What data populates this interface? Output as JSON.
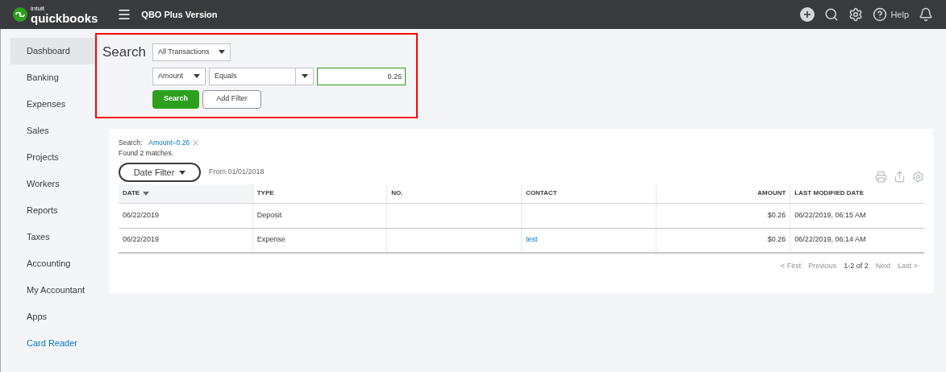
{
  "topbar": {
    "logo_small": "intuit",
    "logo": "quickbooks",
    "title": "QBO Plus Version",
    "help": "Help"
  },
  "sidebar": {
    "items": [
      {
        "label": "Dashboard",
        "selected": true,
        "kind": "page"
      },
      {
        "label": "Banking",
        "selected": false,
        "kind": "page"
      },
      {
        "label": "Expenses",
        "selected": false,
        "kind": "page"
      },
      {
        "label": "Sales",
        "selected": false,
        "kind": "page"
      },
      {
        "label": "Projects",
        "selected": false,
        "kind": "page"
      },
      {
        "label": "Workers",
        "selected": false,
        "kind": "page"
      },
      {
        "label": "Reports",
        "selected": false,
        "kind": "page"
      },
      {
        "label": "Taxes",
        "selected": false,
        "kind": "page"
      },
      {
        "label": "Accounting",
        "selected": false,
        "kind": "page"
      },
      {
        "label": "My Accountant",
        "selected": false,
        "kind": "page"
      },
      {
        "label": "Apps",
        "selected": false,
        "kind": "page"
      },
      {
        "label": "Card Reader",
        "selected": false,
        "kind": "link"
      }
    ]
  },
  "search": {
    "title": "Search",
    "transaction_type": "All Transactions",
    "field": "Amount",
    "operator": "Equals",
    "value": "0.26",
    "search_button": "Search",
    "add_filter_button": "Add Filter"
  },
  "results": {
    "search_label": "Search:",
    "search_term": "Amount=0.26",
    "found": "Found 2 matches.",
    "date_filter": "Date Filter",
    "date_range": "From 01/01/2018",
    "table": {
      "columns": [
        {
          "label": "DATE",
          "sorted": true,
          "kind": "text"
        },
        {
          "label": "TYPE",
          "sorted": false,
          "kind": "text"
        },
        {
          "label": "NO.",
          "sorted": false,
          "kind": "text"
        },
        {
          "label": "CONTACT",
          "sorted": false,
          "kind": "text"
        },
        {
          "label": "AMOUNT",
          "sorted": false,
          "kind": "number"
        },
        {
          "label": "LAST MODIFIED DATE",
          "sorted": false,
          "kind": "text"
        }
      ],
      "rows": [
        {
          "cells": [
            {
              "text": "06/22/2019"
            },
            {
              "text": "Deposit"
            },
            {
              "text": ""
            },
            {
              "text": ""
            },
            {
              "text": "$0.26"
            },
            {
              "text": "06/22/2019, 06:15 AM"
            }
          ]
        },
        {
          "cells": [
            {
              "text": "06/22/2019"
            },
            {
              "text": "Expense"
            },
            {
              "text": ""
            },
            {
              "text": "test",
              "kind": "link"
            },
            {
              "text": "$0.26"
            },
            {
              "text": "06/22/2019, 06:14 AM"
            }
          ]
        }
      ]
    },
    "pagination": [
      {
        "label": "< First",
        "disabled": true
      },
      {
        "label": "Previous",
        "disabled": true
      },
      {
        "label": "1-2 of 2",
        "kind": "range"
      },
      {
        "label": "Next",
        "disabled": true
      },
      {
        "label": "Last >",
        "disabled": true
      }
    ]
  }
}
